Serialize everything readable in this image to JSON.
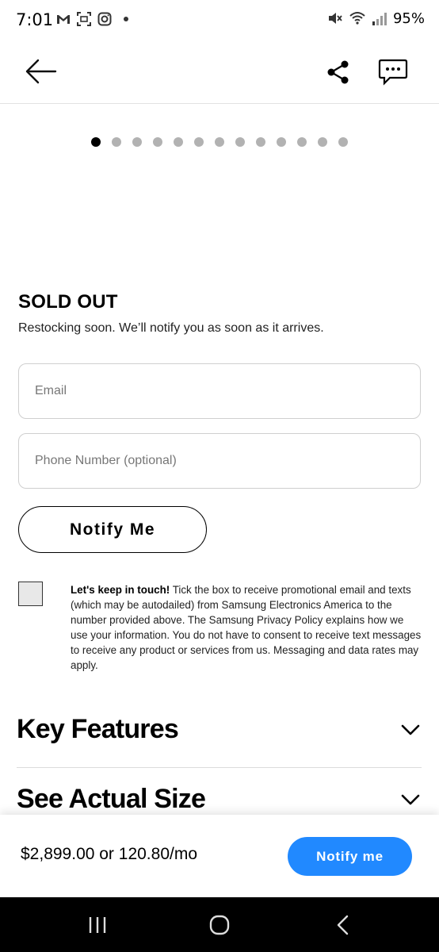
{
  "status_bar": {
    "time": "7:01",
    "battery": "95%",
    "icons": [
      "gmail-icon",
      "screenshot-icon",
      "instagram-icon",
      "mute-icon",
      "wifi-icon",
      "signal-icon"
    ]
  },
  "header": {
    "icons": [
      "back-arrow-icon",
      "share-icon",
      "chat-icon"
    ]
  },
  "carousel": {
    "total": 13,
    "active_index": 0
  },
  "sold_out": {
    "title": "SOLD OUT",
    "subtitle": "Restocking soon. We’ll notify you as soon as it arrives.",
    "email_placeholder": "Email",
    "phone_placeholder": "Phone Number (optional)",
    "notify_label": "Notify Me"
  },
  "consent": {
    "bold": "Let's keep in touch!",
    "text": " Tick the box to receive promotional email and texts (which may be autodailed) from Samsung Electronics America to the number provided above. The Samsung Privacy Policy explains how we use your information. You do not have to consent to receive text messages to receive any product or services from us. Messaging and data rates may apply.",
    "checked": false
  },
  "accordions": [
    {
      "label": "Key Features"
    },
    {
      "label": "See Actual Size"
    }
  ],
  "buy_bar": {
    "price": "$2,899.00 or 120.80/mo",
    "button": "Notify me",
    "button_color": "#2189ff"
  }
}
